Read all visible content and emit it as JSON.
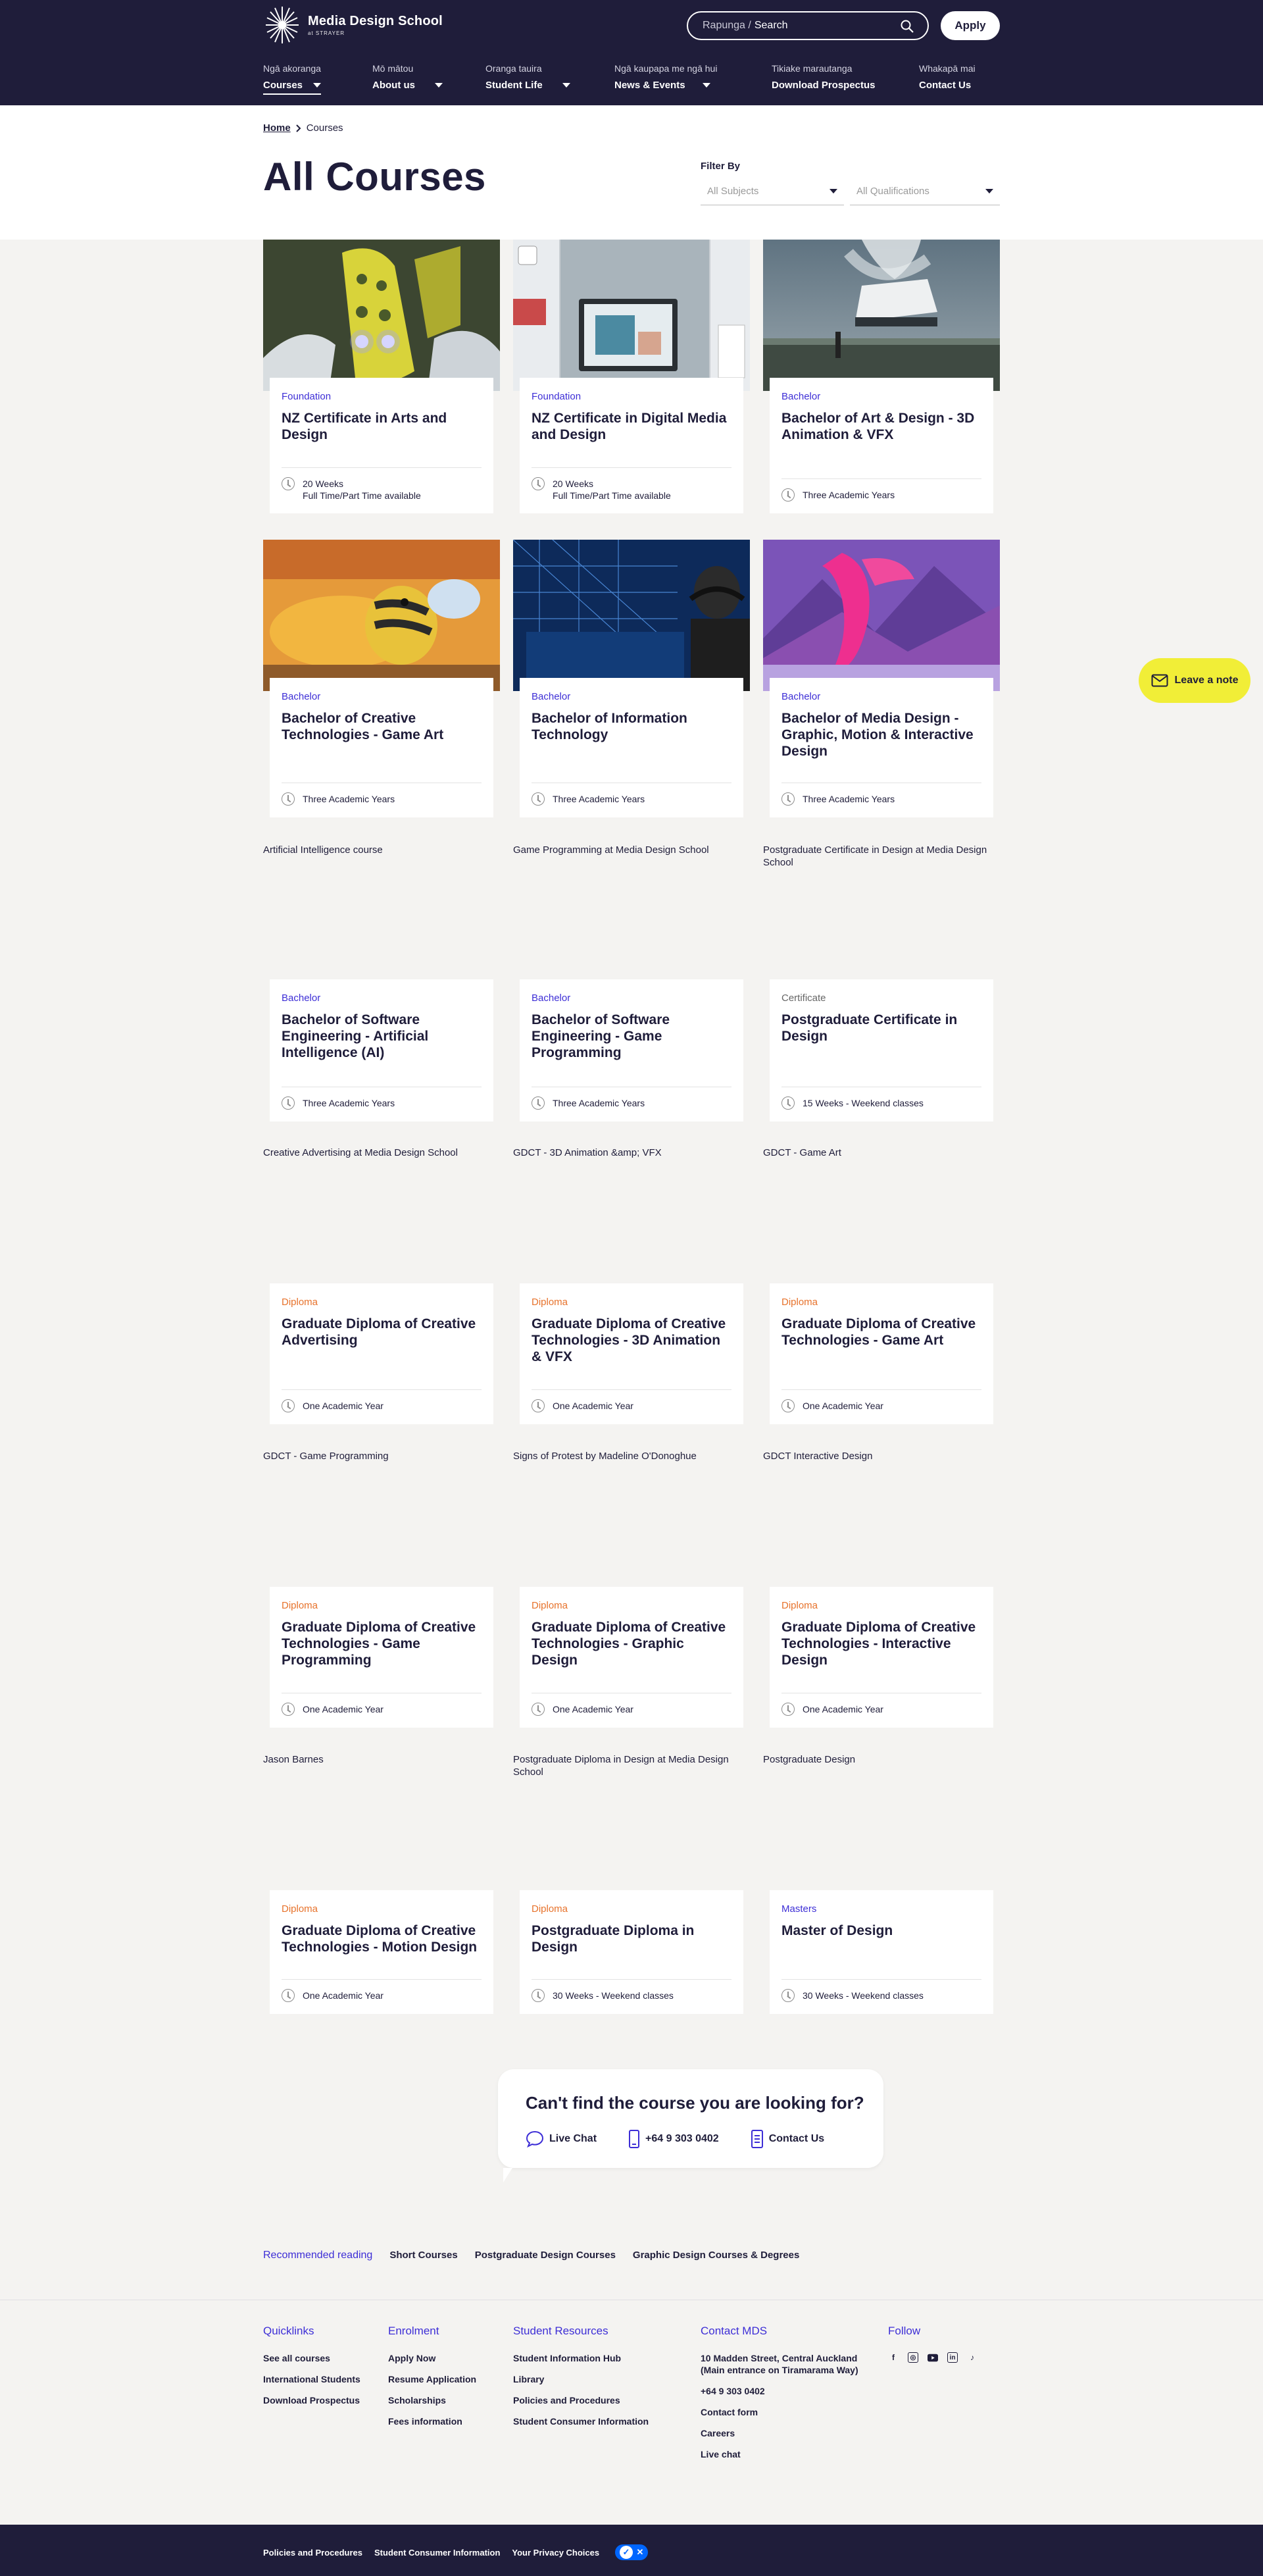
{
  "brand": {
    "name": "Media Design School",
    "sub": "at STRAYER"
  },
  "header": {
    "search_placeholder_a": "Rapunga /",
    "search_placeholder_b": "Search",
    "apply_label": "Apply",
    "nav": [
      {
        "maori": "Ngā akoranga",
        "label": "Courses",
        "dropdown": true,
        "active": true
      },
      {
        "maori": "Mō mātou",
        "label": "About us",
        "dropdown": true
      },
      {
        "maori": "Oranga tauira",
        "label": "Student Life",
        "dropdown": true
      },
      {
        "maori": "Ngā kaupapa me ngā hui",
        "label": "News & Events",
        "dropdown": true
      },
      {
        "maori": "Tikiake marautanga",
        "label": "Download Prospectus",
        "dropdown": false
      },
      {
        "maori": "Whakapā mai",
        "label": "Contact Us",
        "dropdown": false
      }
    ]
  },
  "breadcrumb": {
    "home": "Home",
    "current": "Courses"
  },
  "page_title": "All Courses",
  "filter": {
    "label": "Filter By",
    "subjects": "All Subjects",
    "qualifications": "All Qualifications"
  },
  "courses": [
    {
      "level": "Foundation",
      "level_color": "blue",
      "title": "NZ Certificate in Arts and Design",
      "meta1": "20 Weeks",
      "meta2": "Full Time/Part Time available",
      "image": "arts"
    },
    {
      "level": "Foundation",
      "level_color": "blue",
      "title": "NZ Certificate in Digital Media and Design",
      "meta1": "20 Weeks",
      "meta2": "Full Time/Part Time available",
      "image": "digital"
    },
    {
      "level": "Bachelor",
      "level_color": "blue",
      "title": "Bachelor of Art & Design - 3D Animation & VFX",
      "meta1": "Three Academic Years",
      "image": "vfx"
    },
    {
      "level": "Bachelor",
      "level_color": "blue",
      "title": "Bachelor of Creative Technologies - Game Art",
      "meta1": "Three Academic Years",
      "image": "gameart"
    },
    {
      "level": "Bachelor",
      "level_color": "blue",
      "title": "Bachelor of Information Technology",
      "meta1": "Three Academic Years",
      "image": "it"
    },
    {
      "level": "Bachelor",
      "level_color": "blue",
      "title": "Bachelor of Media Design - Graphic, Motion & Interactive Design",
      "meta1": "Three Academic Years",
      "image": "media"
    },
    {
      "level": "Bachelor",
      "level_color": "blue",
      "title": "Bachelor of Software Engineering - Artificial Intelligence (AI)",
      "meta1": "Three Academic Years",
      "alt": "Artificial Intelligence course"
    },
    {
      "level": "Bachelor",
      "level_color": "blue",
      "title": "Bachelor of Software Engineering - Game Programming",
      "meta1": "Three Academic Years",
      "alt": "Game Programming at Media Design School"
    },
    {
      "level": "Certificate",
      "level_color": "grey",
      "title": "Postgraduate Certificate in Design",
      "meta1": "15 Weeks - Weekend classes",
      "alt": "Postgraduate Certificate in Design at Media Design School"
    },
    {
      "level": "Diploma",
      "level_color": "orange",
      "title": "Graduate Diploma of Creative Advertising",
      "meta1": "One Academic Year",
      "alt": "Creative Advertising at Media Design School"
    },
    {
      "level": "Diploma",
      "level_color": "orange",
      "title": "Graduate Diploma of Creative Technologies - 3D Animation & VFX",
      "meta1": "One Academic Year",
      "alt": "GDCT - 3D Animation &amp; VFX"
    },
    {
      "level": "Diploma",
      "level_color": "orange",
      "title": "Graduate Diploma of Creative Technologies - Game Art",
      "meta1": "One Academic Year",
      "alt": "GDCT - Game Art"
    },
    {
      "level": "Diploma",
      "level_color": "orange",
      "title": "Graduate Diploma of Creative Technologies - Game Programming",
      "meta1": "One Academic Year",
      "alt": "GDCT - Game Programming"
    },
    {
      "level": "Diploma",
      "level_color": "orange",
      "title": "Graduate Diploma of Creative Technologies - Graphic Design",
      "meta1": "One Academic Year",
      "alt": "Signs of Protest by Madeline O'Donoghue"
    },
    {
      "level": "Diploma",
      "level_color": "orange",
      "title": "Graduate Diploma of Creative Technologies - Interactive Design",
      "meta1": "One Academic Year",
      "alt": "GDCT Interactive Design"
    },
    {
      "level": "Diploma",
      "level_color": "orange",
      "title": "Graduate Diploma of Creative Technologies - Motion Design",
      "meta1": "One Academic Year",
      "alt": "Jason Barnes"
    },
    {
      "level": "Diploma",
      "level_color": "orange",
      "title": "Postgraduate Diploma in Design",
      "meta1": "30 Weeks - Weekend classes",
      "alt": "Postgraduate Diploma in Design at Media Design School"
    },
    {
      "level": "Masters",
      "level_color": "blue",
      "title": "Master of Design",
      "meta1": "30 Weeks - Weekend classes",
      "alt": "Postgraduate Design"
    }
  ],
  "note_button": "Leave a note",
  "help": {
    "title": "Can't find the course you are looking for?",
    "chat": "Live Chat",
    "phone": "+64 9 303 0402",
    "contact": "Contact Us"
  },
  "recommended": {
    "title": "Recommended reading",
    "links": [
      "Short Courses",
      "Postgraduate Design Courses",
      "Graphic Design Courses & Degrees"
    ]
  },
  "footer": {
    "quicklinks": {
      "title": "Quicklinks",
      "links": [
        "See all courses",
        "International Students",
        "Download Prospectus"
      ]
    },
    "enrolment": {
      "title": "Enrolment",
      "links": [
        "Apply Now",
        "Resume Application",
        "Scholarships",
        "Fees information"
      ]
    },
    "resources": {
      "title": "Student Resources",
      "links": [
        "Student Information Hub",
        "Library",
        "Policies and Procedures",
        "Student Consumer Information"
      ]
    },
    "contact": {
      "title": "Contact MDS",
      "address": "10 Madden Street, Central Auckland (Main entrance on Tiramarama Way)",
      "phone": "+64 9 303 0402",
      "links": [
        "Contact form",
        "Careers",
        "Live chat"
      ]
    },
    "follow": {
      "title": "Follow",
      "icons": [
        "facebook-icon",
        "instagram-icon",
        "youtube-icon",
        "linkedin-icon",
        "tiktok-icon"
      ]
    },
    "bottom_links": [
      "Policies and Procedures",
      "Student Consumer Information",
      "Your Privacy Choices"
    ]
  },
  "colors": {
    "navy": "#1f1d3a",
    "accent_blue": "#3d2ed6",
    "diploma_orange": "#e7722b",
    "note_yellow": "#f1ee37"
  }
}
